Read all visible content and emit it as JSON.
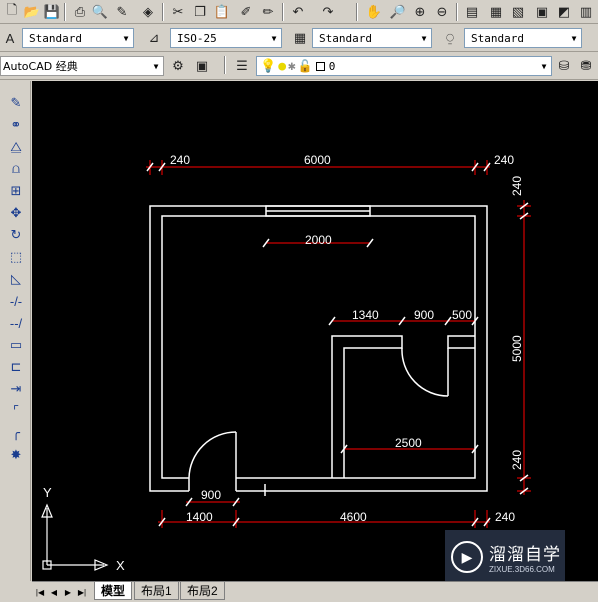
{
  "toolbar_top": {
    "icons": [
      "new-icon",
      "open-icon",
      "save-icon",
      "plot-icon",
      "preview-icon",
      "publish-icon",
      "3d-icon",
      "cut-icon",
      "copy-icon",
      "paste-icon",
      "matchprop-icon",
      "blockeditor-icon",
      "undo-icon",
      "redo-icon",
      "pan-icon",
      "zoom-realtime-icon",
      "zoom-window-icon",
      "zoom-previous-icon",
      "properties-icon",
      "designcenter-icon",
      "toolpalettes-icon",
      "sheetset-icon",
      "markup-icon",
      "quickcalc-icon"
    ]
  },
  "styles_toolbar": {
    "text_style": "Standard",
    "dim_style": "ISO-25",
    "table_style": "Standard",
    "multileader_style": "Standard"
  },
  "workspace_toolbar": {
    "workspace": "AutoCAD 经典",
    "layer_name": "0"
  },
  "drawing": {
    "dim_labels": {
      "top_left": "240",
      "top_middle": "6000",
      "top_right": "240",
      "right_top": "240",
      "right_middle": "5000",
      "right_bottom": "240",
      "window": "2000",
      "inner_1340": "1340",
      "inner_900": "900",
      "inner_500": "500",
      "inner_2500": "2500",
      "door_900": "900",
      "bottom_1400": "1400",
      "bottom_4600": "4600",
      "bottom_240": "240"
    },
    "ucs": {
      "x_label": "X",
      "y_label": "Y"
    }
  },
  "tabs": {
    "model": "模型",
    "layout1": "布局1",
    "layout2": "布局2"
  },
  "watermark": {
    "title": "溜溜自学",
    "url": "ZIXUE.3D66.COM"
  },
  "colors": {
    "canvas": "#000000",
    "wall": "#ffffff",
    "dimension": "#ff0000",
    "dim_text": "#ffffff"
  }
}
